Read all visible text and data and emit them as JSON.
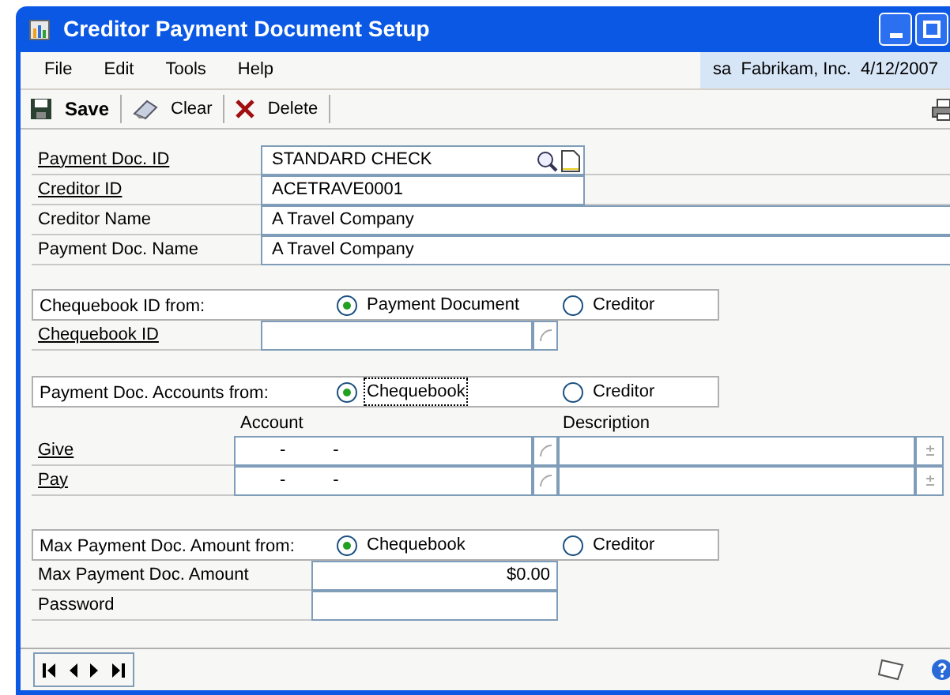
{
  "window": {
    "title": "Creditor Payment Document Setup"
  },
  "menu": [
    {
      "label": "File"
    },
    {
      "label": "Edit"
    },
    {
      "label": "Tools"
    },
    {
      "label": "Help"
    }
  ],
  "user_info": "sa  Fabrikam, Inc.  4/12/2007",
  "toolbar": [
    {
      "label": "Save",
      "kind": "save"
    },
    {
      "label": "Clear",
      "kind": "clear"
    },
    {
      "label": "Delete",
      "kind": "delete"
    }
  ],
  "header_fields": [
    {
      "label": "Payment Doc. ID",
      "link": true,
      "value": "STANDARD CHECK",
      "kind": "lookup"
    },
    {
      "label": "Creditor ID",
      "link": true,
      "value": "ACETRAVE0001",
      "kind": "short"
    },
    {
      "label": "Creditor Name",
      "link": false,
      "value": "A Travel Company",
      "kind": "wide"
    },
    {
      "label": "Payment Doc. Name",
      "link": false,
      "value": "A Travel Company",
      "kind": "wide"
    }
  ],
  "chequebook_source": {
    "label": "Chequebook ID from:",
    "options": [
      {
        "label": "Payment Document",
        "selected": true,
        "focused": false
      },
      {
        "label": "Creditor",
        "selected": false,
        "focused": false
      }
    ]
  },
  "chequebook_id": {
    "label": "Chequebook ID",
    "link": true
  },
  "accounts_source": {
    "label": "Payment Doc. Accounts from:",
    "options": [
      {
        "label": "Chequebook",
        "selected": true,
        "focused": true
      },
      {
        "label": "Creditor",
        "selected": false,
        "focused": false
      }
    ]
  },
  "accounts": {
    "columns": [
      "Account",
      "Description"
    ],
    "rows": [
      {
        "label": "Give",
        "link": true,
        "account": [
          "-",
          "-"
        ]
      },
      {
        "label": "Pay",
        "link": true,
        "account": [
          "-",
          "-"
        ]
      }
    ]
  },
  "max_amount_source": {
    "label": "Max Payment Doc. Amount from:",
    "options": [
      {
        "label": "Chequebook",
        "selected": true,
        "focused": false
      },
      {
        "label": "Creditor",
        "selected": false,
        "focused": false
      }
    ]
  },
  "max_amount": {
    "label": "Max Payment Doc. Amount",
    "link": false,
    "value": "$0.00"
  },
  "password": {
    "label": "Password",
    "link": false
  }
}
